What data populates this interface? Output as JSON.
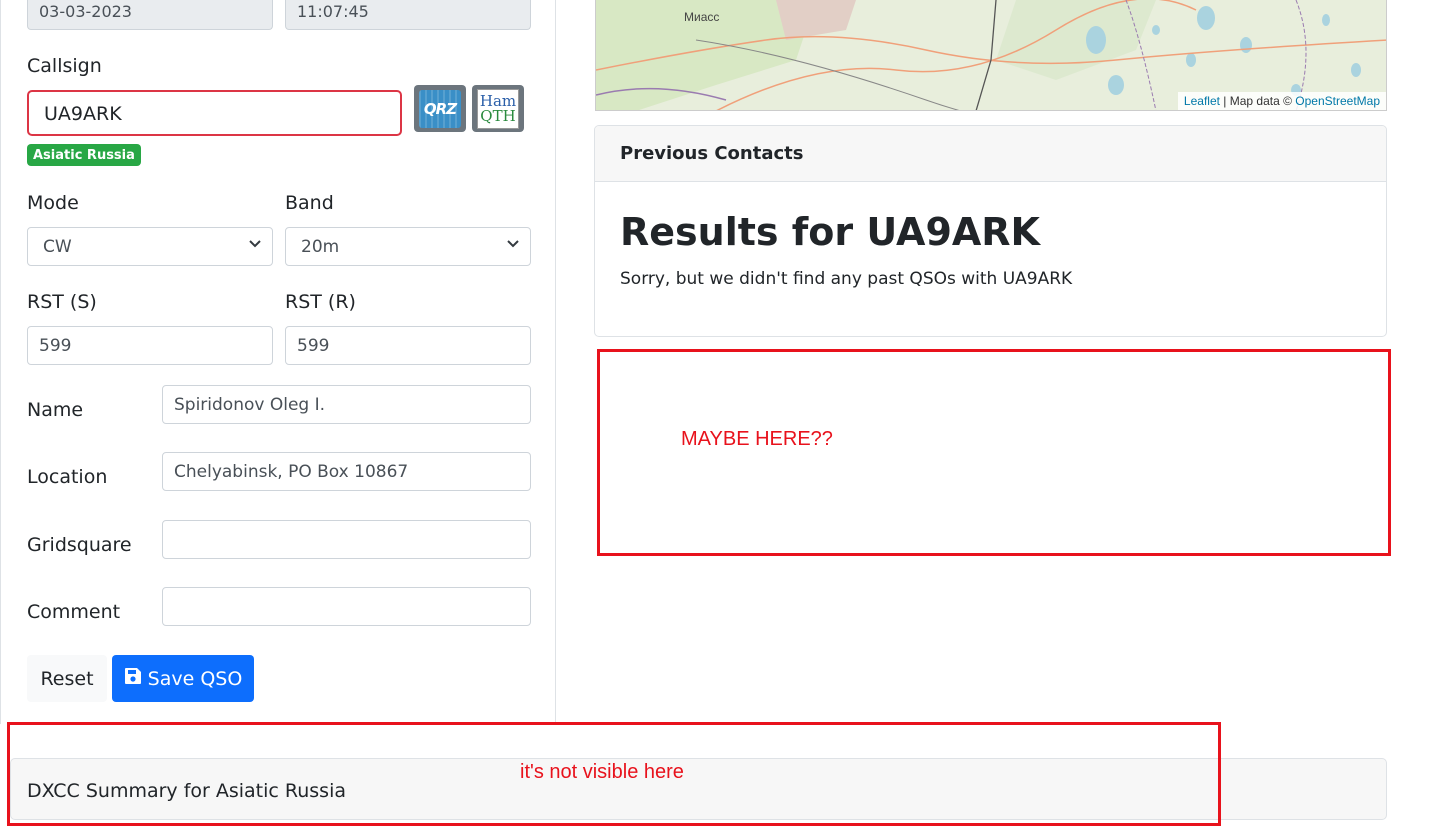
{
  "qso": {
    "date": "03-03-2023",
    "time": "11:07:45",
    "callsign_label": "Callsign",
    "callsign_value": "UA9ARK",
    "qrz_button": "QRZ",
    "hamqth_button_line1": "Ham",
    "hamqth_button_line2": "QTH",
    "country_badge": "Asiatic Russia",
    "mode_label": "Mode",
    "mode_value": "CW",
    "band_label": "Band",
    "band_value": "20m",
    "rst_s_label": "RST (S)",
    "rst_s_value": "599",
    "rst_r_label": "RST (R)",
    "rst_r_value": "599",
    "name_label": "Name",
    "name_value": "Spiridonov Oleg I.",
    "location_label": "Location",
    "location_value": "Chelyabinsk, PO Box 10867",
    "gridsquare_label": "Gridsquare",
    "gridsquare_value": "",
    "comment_label": "Comment",
    "comment_value": "",
    "reset_button": "Reset",
    "save_button": "Save QSO"
  },
  "map": {
    "city_label": "Миасс",
    "attribution_leaflet": "Leaflet",
    "attribution_sep": " | Map data © ",
    "attribution_osm": "OpenStreetMap"
  },
  "previous_contacts": {
    "header": "Previous Contacts",
    "title": "Results for UA9ARK",
    "message": "Sorry, but we didn't find any past QSOs with UA9ARK"
  },
  "annotations": {
    "maybe_here": "MAYBE HERE??",
    "not_visible": "it's not visible here",
    "color": "#e8121c"
  },
  "dxcc_summary": {
    "label": "DXCC Summary for Asiatic Russia"
  },
  "colors": {
    "primary": "#0d6efd",
    "badge_success": "#28a745",
    "invalid_border": "#dc3545"
  }
}
